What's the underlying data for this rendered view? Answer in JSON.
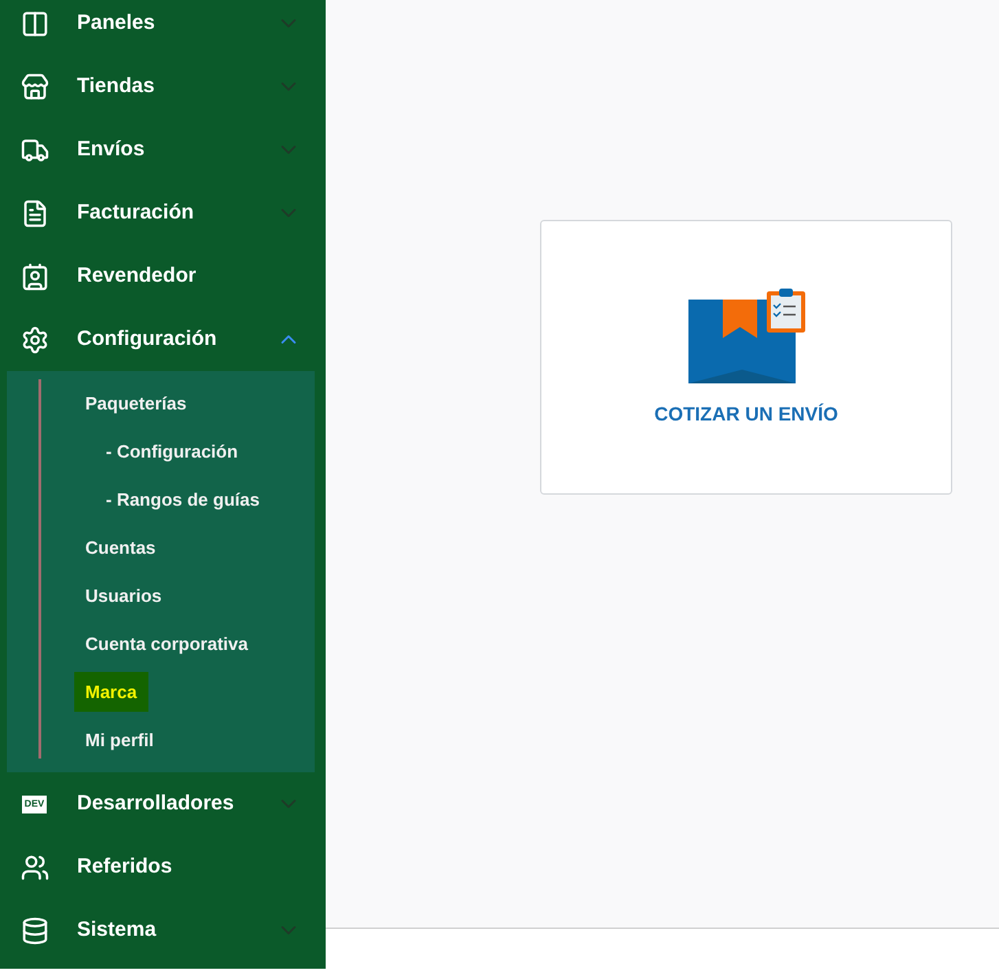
{
  "sidebar": {
    "items": [
      {
        "label": "Paneles",
        "expanded": false
      },
      {
        "label": "Tiendas",
        "expanded": false
      },
      {
        "label": "Envíos",
        "expanded": false
      },
      {
        "label": "Facturación",
        "expanded": false
      },
      {
        "label": "Revendedor"
      },
      {
        "label": "Configuración",
        "expanded": true,
        "children": [
          {
            "label": "Paqueterías",
            "selected": false,
            "children": [
              {
                "label": "- Configuración",
                "selected": false
              },
              {
                "label": "- Rangos de guías",
                "selected": false
              }
            ]
          },
          {
            "label": "Cuentas",
            "selected": false
          },
          {
            "label": "Usuarios",
            "selected": false
          },
          {
            "label": "Cuenta corporativa",
            "selected": false
          },
          {
            "label": "Marca",
            "selected": true
          },
          {
            "label": "Mi perfil",
            "selected": false
          }
        ]
      },
      {
        "label": "Desarrolladores",
        "badge": "DEV",
        "expanded": false
      },
      {
        "label": "Referidos"
      },
      {
        "label": "Sistema",
        "expanded": false
      }
    ]
  },
  "card": {
    "label": "COTIZAR UN ENVÍO"
  }
}
